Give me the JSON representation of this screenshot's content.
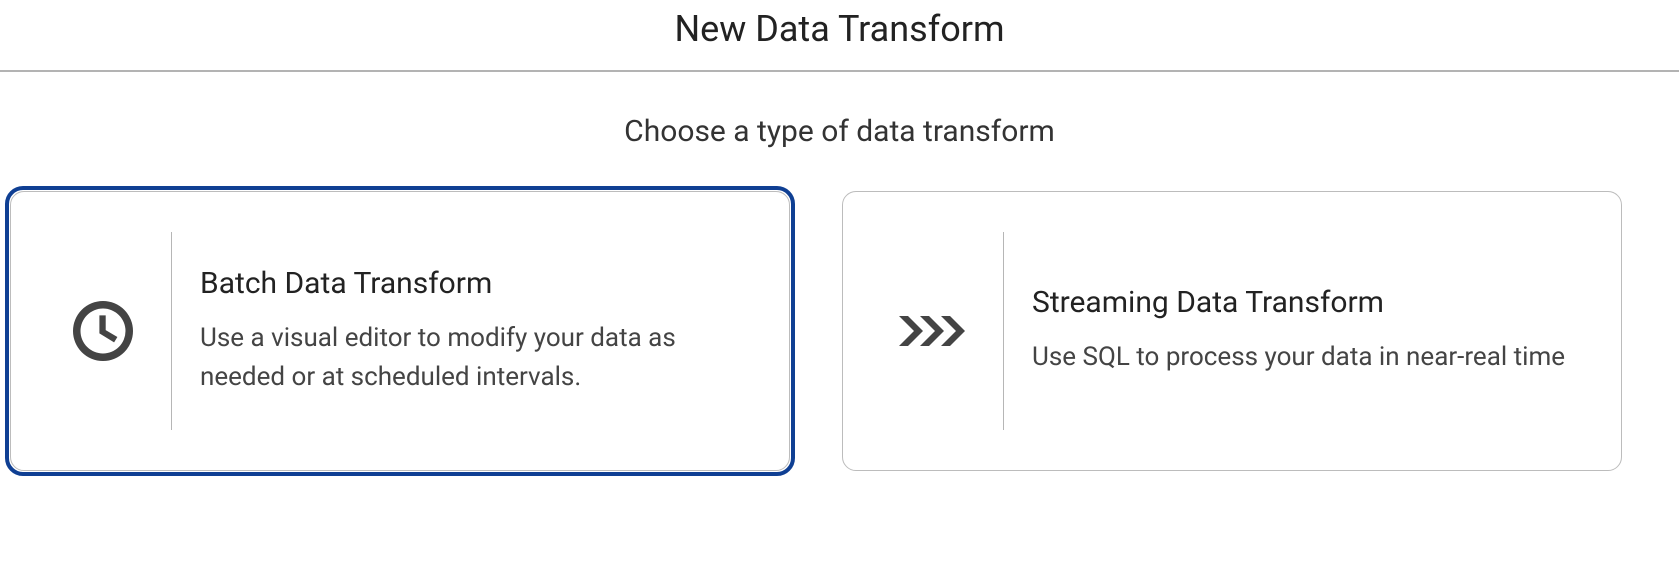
{
  "header": {
    "title": "New Data Transform"
  },
  "subtitle": "Choose a type of data transform",
  "cards": {
    "batch": {
      "title": "Batch Data Transform",
      "description": "Use a visual editor to modify your data as needed or at scheduled intervals.",
      "selected": true,
      "icon": "clock-icon"
    },
    "streaming": {
      "title": "Streaming Data Transform",
      "description": "Use SQL to process your data in near-real time",
      "selected": false,
      "icon": "chevrons-icon"
    }
  }
}
